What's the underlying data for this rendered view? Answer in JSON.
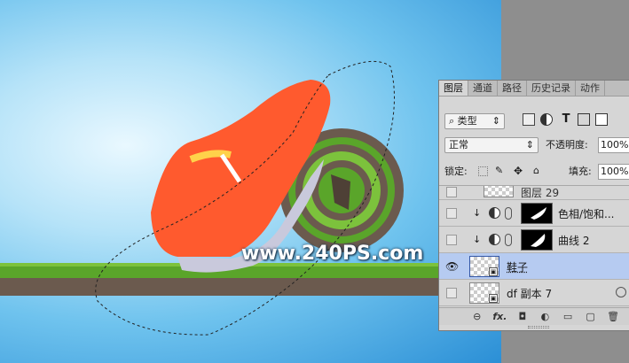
{
  "canvas": {
    "watermark": "www.240PS.com",
    "background_colors": [
      "#e9f8ff",
      "#6fc3ee",
      "#2b8fd6"
    ],
    "grass_color": "#5aa52a",
    "soil_color": "#6b5a4e",
    "shoe_color": "#ff5a2e"
  },
  "layers_panel": {
    "tabs": [
      {
        "label": "图层",
        "active": true
      },
      {
        "label": "通道",
        "active": false
      },
      {
        "label": "路径",
        "active": false
      },
      {
        "label": "历史记录",
        "active": false
      },
      {
        "label": "动作",
        "active": false
      }
    ],
    "filter": {
      "label": "类型",
      "icons": [
        "image-filter-icon",
        "adjustment-filter-icon",
        "type-filter-icon",
        "shape-filter-icon",
        "smartobject-filter-icon"
      ]
    },
    "blend_mode": "正常",
    "opacity_label": "不透明度:",
    "opacity_value": "100%",
    "lock_label": "锁定:",
    "fill_label": "填充:",
    "fill_value": "100%",
    "layers": [
      {
        "name": "图层 29",
        "visible": false,
        "selected": false
      },
      {
        "name": "色相/饱和...",
        "visible": false,
        "selected": false
      },
      {
        "name": "曲线 2",
        "visible": false,
        "selected": false
      },
      {
        "name": "鞋子",
        "visible": true,
        "selected": true
      },
      {
        "name": "df 副本 7",
        "visible": false,
        "selected": false
      }
    ],
    "bottom_icons": [
      "link-icon",
      "fx-icon",
      "mask-icon",
      "adjustment-icon",
      "folder-icon",
      "new-layer-icon",
      "trash-icon"
    ],
    "fx_label": "fx."
  }
}
